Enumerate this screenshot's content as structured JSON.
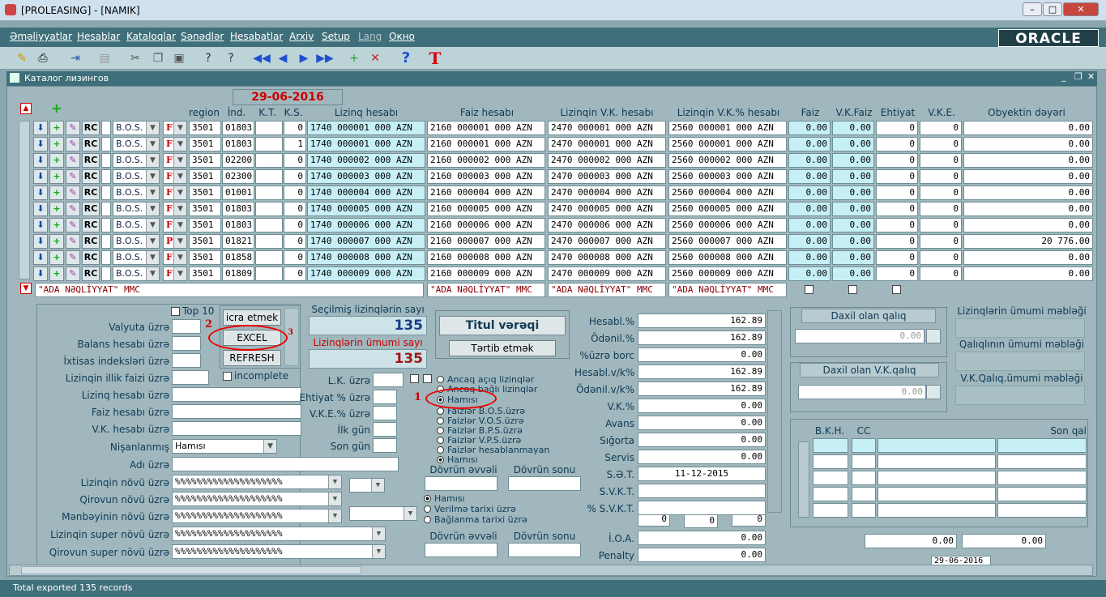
{
  "window": {
    "title": "[PROLEASING] - [NAMIK]"
  },
  "menu": [
    "Əməliyyatlar",
    "Hesablar",
    "Kataloqlar",
    "Sənədlər",
    "Hesabatlar",
    "Arxiv",
    "Setup",
    "Lang",
    "Окно"
  ],
  "brand": "ORACLE",
  "form": {
    "title": "Каталог лизингов",
    "date": "29-06-2016"
  },
  "grid": {
    "headers": {
      "region": "region",
      "ind": "İnd.",
      "kt": "K.T.",
      "ks": "K.S.",
      "lizinq": "Lizinq hesabı",
      "faiz": "Faiz hesabı",
      "vk": "Lizinqin V.K. hesabı",
      "vkp": "Lizinqin V.K.% hesabı",
      "faizc": "Faiz",
      "vkfaiz": "V.K.Faiz",
      "ehtiyat": "Ehtiyat",
      "vke": "V.K.E.",
      "obyekt": "Obyektin dəyəri"
    },
    "rows": [
      {
        "type": "B.O.S.",
        "f": "F",
        "region": "3501",
        "ind": "01803",
        "ks": "0",
        "lizinq": "1740 000001 000 AZN",
        "faiz": "2160 000001 000 AZN",
        "vk": "2470 000001 000 AZN",
        "vkp": "2560 000001 000 AZN",
        "faizv": "0.00",
        "vkfaiz": "0.00",
        "ehtiyat": "0",
        "vke": "0",
        "obyekt": "0.00"
      },
      {
        "type": "B.O.S.",
        "f": "F",
        "region": "3501",
        "ind": "01803",
        "ks": "1",
        "lizinq": "1740 000001 000 AZN",
        "faiz": "2160 000001 000 AZN",
        "vk": "2470 000001 000 AZN",
        "vkp": "2560 000001 000 AZN",
        "faizv": "0.00",
        "vkfaiz": "0.00",
        "ehtiyat": "0",
        "vke": "0",
        "obyekt": "0.00"
      },
      {
        "type": "B.O.S.",
        "f": "F",
        "region": "3501",
        "ind": "02200",
        "ks": "0",
        "lizinq": "1740 000002 000 AZN",
        "faiz": "2160 000002 000 AZN",
        "vk": "2470 000002 000 AZN",
        "vkp": "2560 000002 000 AZN",
        "faizv": "0.00",
        "vkfaiz": "0.00",
        "ehtiyat": "0",
        "vke": "0",
        "obyekt": "0.00"
      },
      {
        "type": "B.O.S.",
        "f": "F",
        "region": "3501",
        "ind": "02300",
        "ks": "0",
        "lizinq": "1740 000003 000 AZN",
        "faiz": "2160 000003 000 AZN",
        "vk": "2470 000003 000 AZN",
        "vkp": "2560 000003 000 AZN",
        "faizv": "0.00",
        "vkfaiz": "0.00",
        "ehtiyat": "0",
        "vke": "0",
        "obyekt": "0.00"
      },
      {
        "type": "B.O.S.",
        "f": "F",
        "region": "3501",
        "ind": "01001",
        "ks": "0",
        "lizinq": "1740 000004 000 AZN",
        "faiz": "2160 000004 000 AZN",
        "vk": "2470 000004 000 AZN",
        "vkp": "2560 000004 000 AZN",
        "faizv": "0.00",
        "vkfaiz": "0.00",
        "ehtiyat": "0",
        "vke": "0",
        "obyekt": "0.00"
      },
      {
        "type": "B.O.S.",
        "f": "F",
        "region": "3501",
        "ind": "01803",
        "ks": "0",
        "lizinq": "1740 000005 000 AZN",
        "faiz": "2160 000005 000 AZN",
        "vk": "2470 000005 000 AZN",
        "vkp": "2560 000005 000 AZN",
        "faizv": "0.00",
        "vkfaiz": "0.00",
        "ehtiyat": "0",
        "vke": "0",
        "obyekt": "0.00"
      },
      {
        "type": "B.O.S.",
        "f": "F",
        "region": "3501",
        "ind": "01803",
        "ks": "0",
        "lizinq": "1740 000006 000 AZN",
        "faiz": "2160 000006 000 AZN",
        "vk": "2470 000006 000 AZN",
        "vkp": "2560 000006 000 AZN",
        "faizv": "0.00",
        "vkfaiz": "0.00",
        "ehtiyat": "0",
        "vke": "0",
        "obyekt": "0.00"
      },
      {
        "type": "B.O.S.",
        "f": "P",
        "region": "3501",
        "ind": "01821",
        "ks": "0",
        "lizinq": "1740 000007 000 AZN",
        "faiz": "2160 000007 000 AZN",
        "vk": "2470 000007 000 AZN",
        "vkp": "2560 000007 000 AZN",
        "faizv": "0.00",
        "vkfaiz": "0.00",
        "ehtiyat": "0",
        "vke": "0",
        "obyekt": "20 776.00"
      },
      {
        "type": "B.O.S.",
        "f": "F",
        "region": "3501",
        "ind": "01858",
        "ks": "0",
        "lizinq": "1740 000008 000 AZN",
        "faiz": "2160 000008 000 AZN",
        "vk": "2470 000008 000 AZN",
        "vkp": "2560 000008 000 AZN",
        "faizv": "0.00",
        "vkfaiz": "0.00",
        "ehtiyat": "0",
        "vke": "0",
        "obyekt": "0.00"
      },
      {
        "type": "B.O.S.",
        "f": "F",
        "region": "3501",
        "ind": "01809",
        "ks": "0",
        "lizinq": "1740 000009 000 AZN",
        "faiz": "2160 000009 000 AZN",
        "vk": "2470 000009 000 AZN",
        "vkp": "2560 000009 000 AZN",
        "faizv": "0.00",
        "vkfaiz": "0.00",
        "ehtiyat": "0",
        "vke": "0",
        "obyekt": "0.00"
      }
    ],
    "rc": "RC",
    "footer": [
      "\"ADA NƏQLİYYAT\" MMC",
      "\"ADA NƏQLİYYAT\" MMC",
      "\"ADA NƏQLİYYAT\" MMC",
      "\"ADA NƏQLİYYAT\" MMC"
    ]
  },
  "filters": {
    "top10": "Top 10",
    "labels": [
      "Valyuta üzrə",
      "Balans hesabı üzrə",
      "İxtisas indeksləri üzrə",
      "Lizinqin illik faizi üzrə",
      "Lizinq hesabı üzrə",
      "Faiz hesabı üzrə",
      "V.K. hesabı üzrə",
      "Nişanlanmış",
      "Adı üzrə",
      "Lizinqin növü üzrə",
      "Qirovun növü üzrə",
      "Mənbəyinin növü üzrə",
      "Lizinqin super növü üzrə",
      "Qirovun super növü üzrə"
    ],
    "nisanlanmis": "Hamısı",
    "pct": "%%%%%%%%%%%%%%%%%%%%",
    "incomplete": "incomplete",
    "buttons": {
      "icra": "icra etmek",
      "excel": "EXCEL",
      "refresh": "REFRESH"
    },
    "mid_labels": [
      "L.K. üzrə",
      "Ehtiyat % üzrə",
      "V.K.E.% üzrə",
      "İlk gün",
      "Son gün"
    ]
  },
  "counts": {
    "secilmis_label": "Seçilmiş lizinqlərin sayı",
    "secilmis": "135",
    "umumi_label": "Lizinqlərin ümumi sayı",
    "umumi": "135"
  },
  "radios1": [
    "Ancaq açıq lizinqlər",
    "Ancaq bağlı lizinqlər",
    "Hamısı",
    "Faizlər B.O.S.üzrə",
    "Faizlər V.O.S.üzrə",
    "Faizlər B.P.S.üzrə",
    "Faizlər V.P.S.üzrə",
    "Faizlər hesablanmayan",
    "Hamısı"
  ],
  "period": {
    "evveli": "Dövrün əvvəli",
    "sonu": "Dövrün sonu"
  },
  "radios2": [
    "Hamısı",
    "Verilmə tarixi üzrə",
    "Bağlanma tarixi üzrə"
  ],
  "titul": {
    "title": "Titul vərəqi",
    "button": "Tərtib etmək"
  },
  "stats": [
    {
      "label": "Hesabl.%",
      "value": "162.89"
    },
    {
      "label": "Ödənil.%",
      "value": "162.89"
    },
    {
      "label": "%üzrə borc",
      "value": "0.00"
    },
    {
      "label": "Hesabl.v/k%",
      "value": "162.89"
    },
    {
      "label": "Ödənil.v/k%",
      "value": "162.89"
    },
    {
      "label": "V.K.%",
      "value": "0.00"
    },
    {
      "label": "Avans",
      "value": "0.00"
    },
    {
      "label": "Sığorta",
      "value": "0.00"
    },
    {
      "label": "Servis",
      "value": "0.00"
    },
    {
      "label": "S.Ə.T.",
      "value": "11-12-2015"
    },
    {
      "label": "S.V.K.T.",
      "value": ""
    },
    {
      "label": "% S.V.K.T.",
      "value": ""
    }
  ],
  "small": [
    "0",
    "0",
    "0"
  ],
  "ioa": {
    "label": "İ.O.A.",
    "value": "0.00"
  },
  "penalty": {
    "label": "Penalty",
    "value": "0.00"
  },
  "daxil": {
    "qaliq": "Daxil olan qalıq",
    "qaliq_v": "0.00",
    "vk": "Daxil olan V.K.qalıq",
    "vk_v": "0.00"
  },
  "right_labels": [
    "Lizinqlərin ümumi məbləği",
    "Qalıqlının ümumi məbləği",
    "V.K.Qalıq.ümumi məbləği"
  ],
  "bkh": {
    "h1": "B.K.H.",
    "h2": "CC",
    "h3": "Son qal"
  },
  "totals": [
    "0.00",
    "0.00"
  ],
  "bottom_date": "29-06-2016",
  "status": "Total exported 135 records",
  "annot": {
    "a1": "1",
    "a2": "2",
    "a3": "3"
  }
}
